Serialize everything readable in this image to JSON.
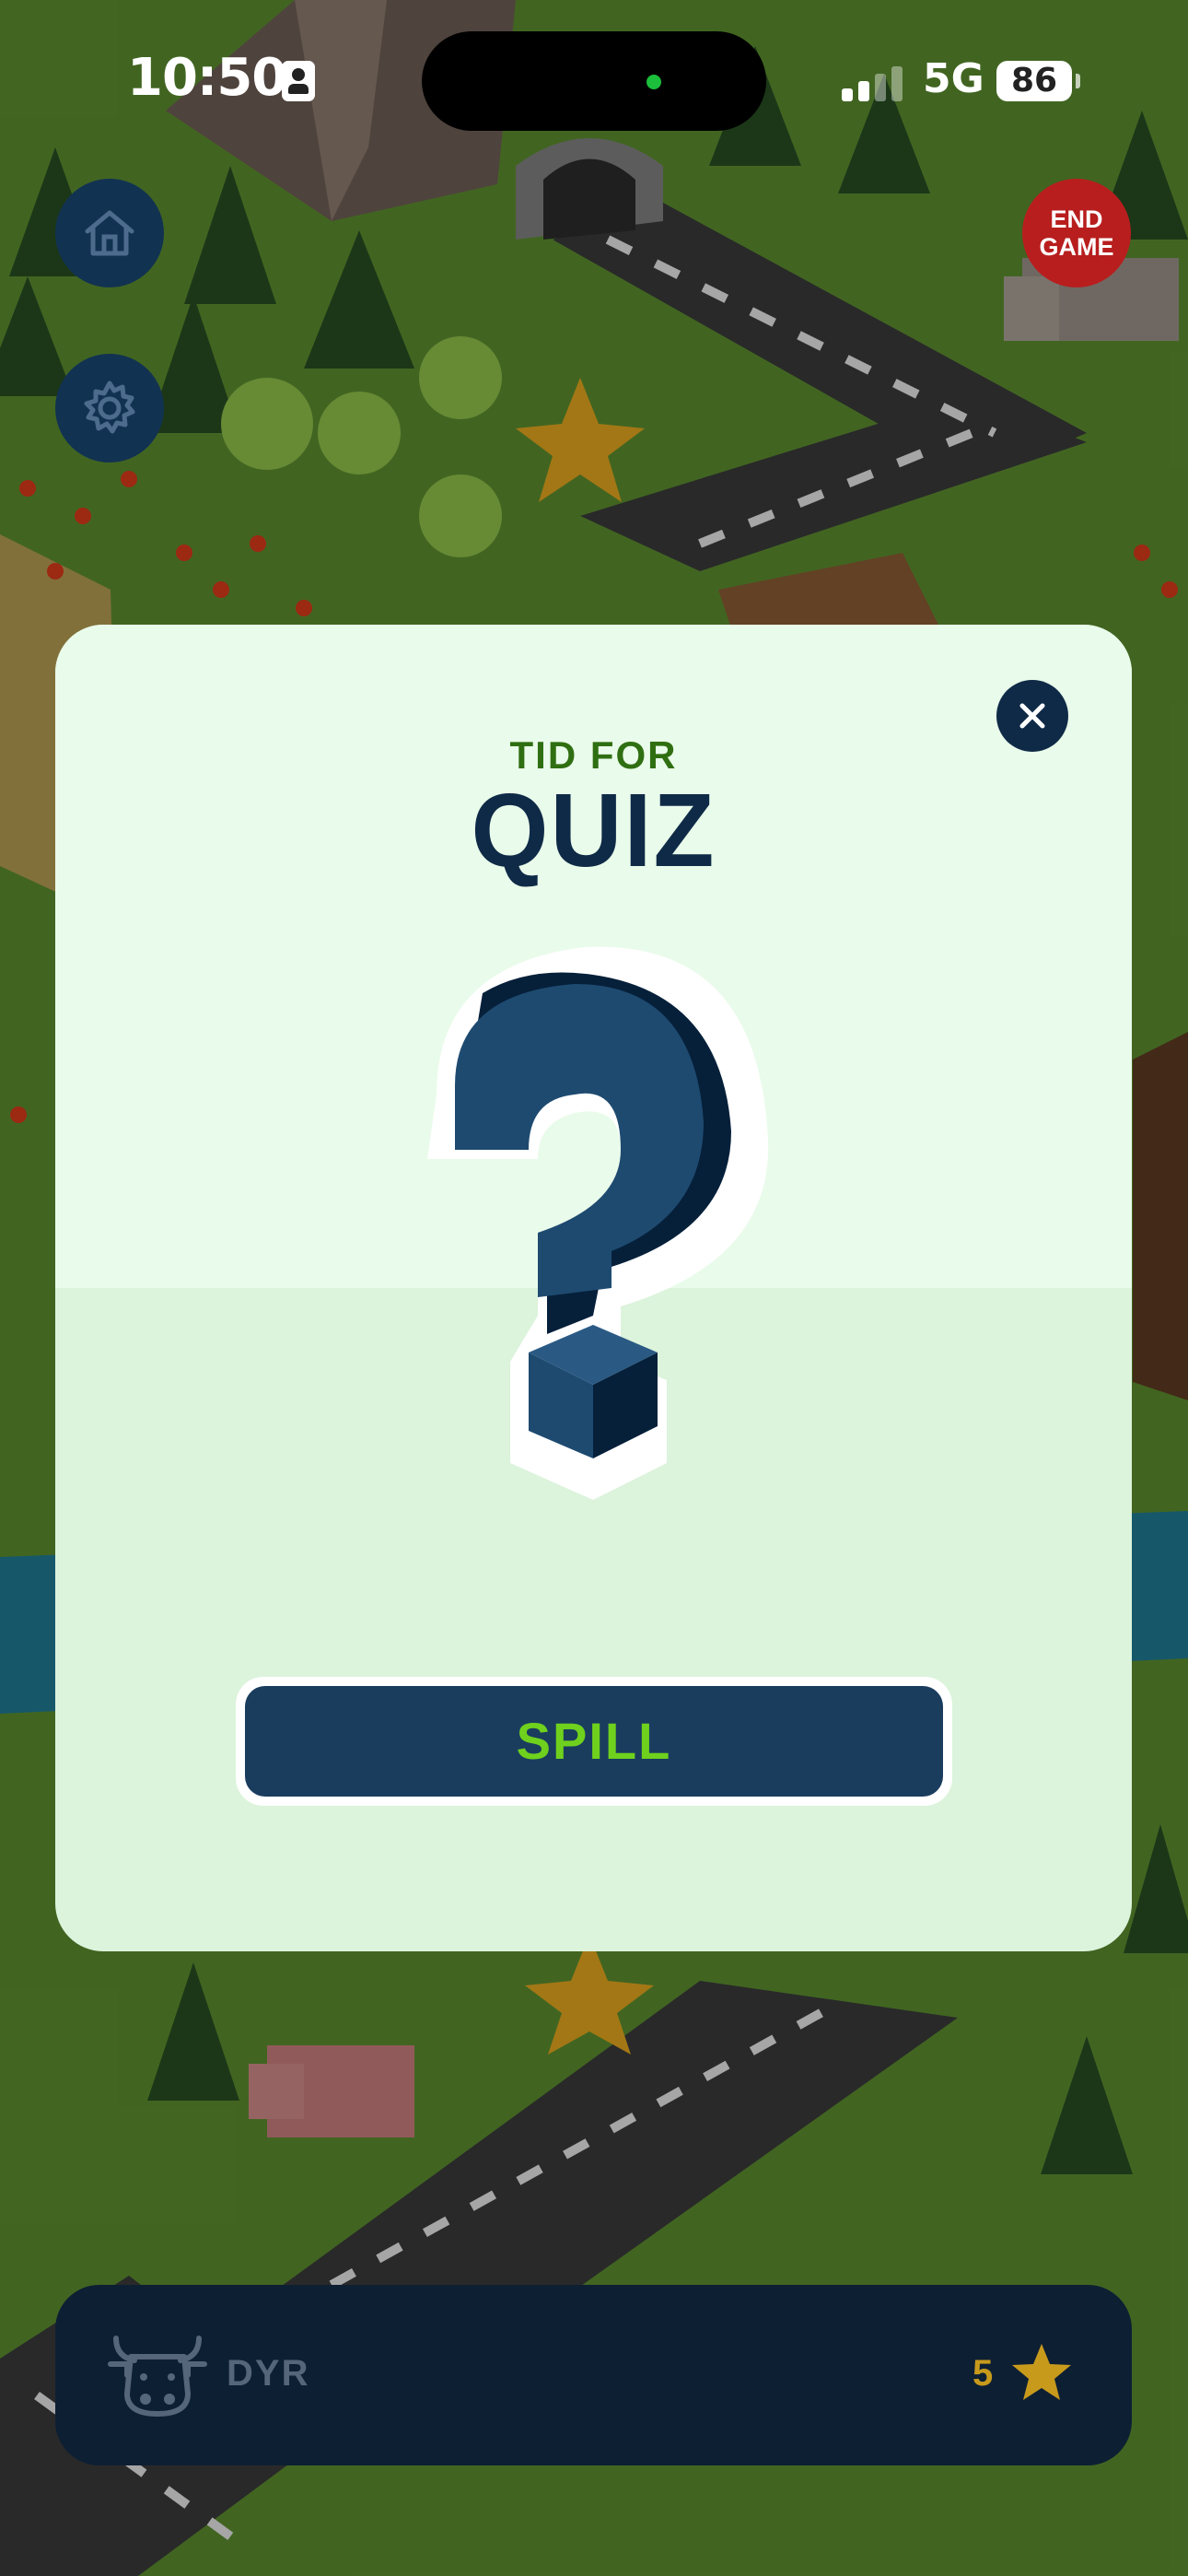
{
  "status_bar": {
    "time": "10:50",
    "network": "5G",
    "battery": "86"
  },
  "hud": {
    "home_icon": "home-icon",
    "settings_icon": "gear-icon",
    "end_game_label_line1": "END",
    "end_game_label_line2": "GAME",
    "end_game_color": "#b81e1e"
  },
  "modal": {
    "subtitle": "TID FOR",
    "title": "QUIZ",
    "close_icon": "close-icon",
    "illustration": "question-mark-icon",
    "play_label": "SPILL",
    "accent_green": "#6fd11d",
    "navy": "#0f2a47"
  },
  "bottom_bar": {
    "category_icon": "cow-icon",
    "category_label": "DYR",
    "score": "5",
    "score_icon": "star-icon"
  }
}
